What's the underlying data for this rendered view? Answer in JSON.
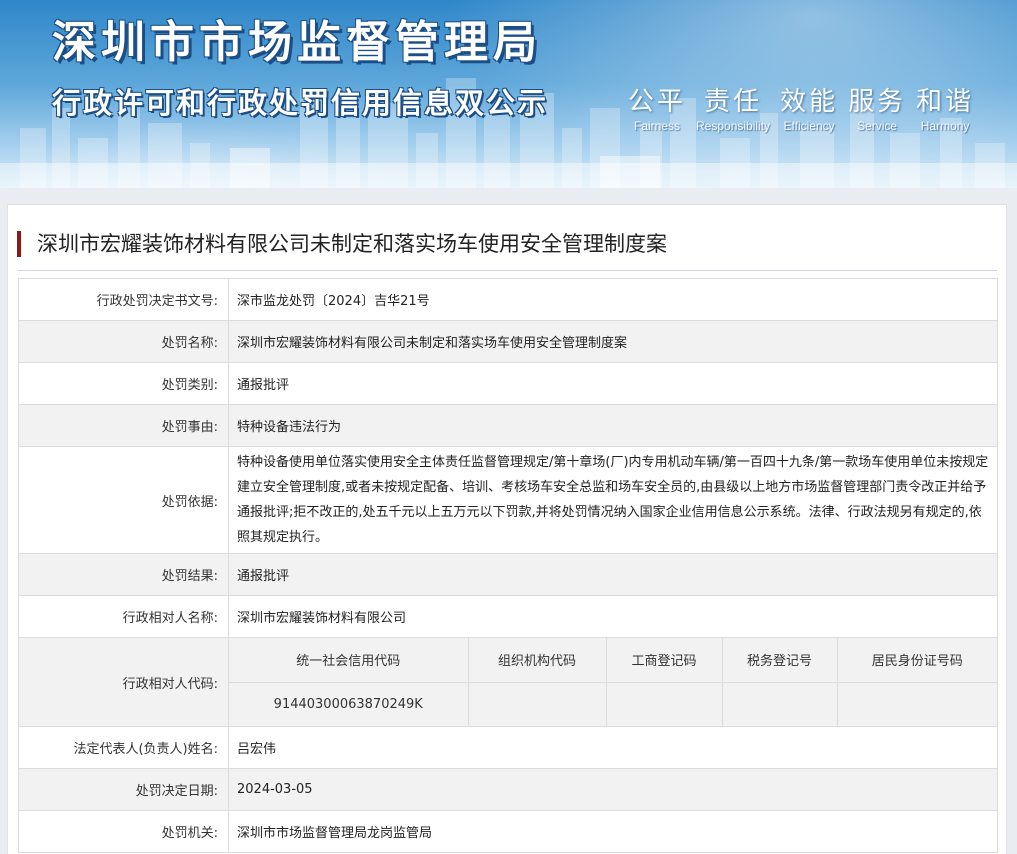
{
  "banner": {
    "title": "深圳市市场监督管理局",
    "subtitle": "行政许可和行政处罚信用信息双公示",
    "values": [
      {
        "cn": "公平",
        "en": "Fairness"
      },
      {
        "cn": "责任",
        "en": "Responsibility"
      },
      {
        "cn": "效能",
        "en": "Efficiency"
      },
      {
        "cn": "服务",
        "en": "Service"
      },
      {
        "cn": "和谐",
        "en": "Harmony"
      }
    ],
    "colors": {
      "sky_top": "#2f87c9",
      "text_outline": "#1b4e86"
    }
  },
  "case": {
    "title": "深圳市宏耀装饰材料有限公司未制定和落实场车使用安全管理制度案",
    "accent_color": "#8b1a1a"
  },
  "fields": {
    "doc_no": {
      "label": "行政处罚决定书文号:",
      "value": "深市监龙处罚〔2024〕吉华21号"
    },
    "penalty_name": {
      "label": "处罚名称:",
      "value": "深圳市宏耀装饰材料有限公司未制定和落实场车使用安全管理制度案"
    },
    "penalty_type": {
      "label": "处罚类别:",
      "value": "通报批评"
    },
    "penalty_reason": {
      "label": "处罚事由:",
      "value": "特种设备违法行为"
    },
    "penalty_basis": {
      "label": "处罚依据:",
      "value": "特种设备使用单位落实使用安全主体责任监督管理规定/第十章场(厂)内专用机动车辆/第一百四十九条/第一款场车使用单位未按规定建立安全管理制度,或者未按规定配备、培训、考核场车安全总监和场车安全员的,由县级以上地方市场监督管理部门责令改正并给予通报批评;拒不改正的,处五千元以上五万元以下罚款,并将处罚情况纳入国家企业信用信息公示系统。法律、行政法规另有规定的,依照其规定执行。"
    },
    "penalty_result": {
      "label": "处罚结果:",
      "value": "通报批评"
    },
    "party_name": {
      "label": "行政相对人名称:",
      "value": "深圳市宏耀装饰材料有限公司"
    },
    "party_code": {
      "label": "行政相对人代码:",
      "headers": [
        "统一社会信用代码",
        "组织机构代码",
        "工商登记码",
        "税务登记号",
        "居民身份证号码"
      ],
      "values": [
        "91440300063870249K",
        "",
        "",
        "",
        ""
      ]
    },
    "legal_rep": {
      "label": "法定代表人(负责人)姓名:",
      "value": "吕宏伟"
    },
    "decision_date": {
      "label": "处罚决定日期:",
      "value": "2024-03-05"
    },
    "authority": {
      "label": "处罚机关:",
      "value": "深圳市市场监督管理局龙岗监管局"
    }
  }
}
